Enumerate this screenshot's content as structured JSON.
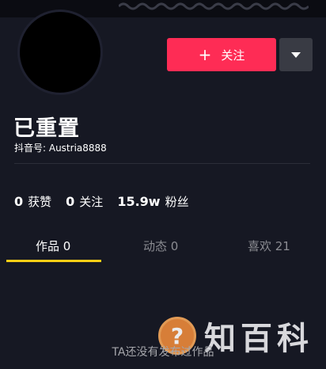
{
  "profile": {
    "nickname": "已重置",
    "douyin_id": "抖音号: Austria8888"
  },
  "actions": {
    "follow_plus": "+",
    "follow_label": "关注",
    "more_icon": "caret-down-icon"
  },
  "stats": [
    {
      "num": "0",
      "label": "获赞"
    },
    {
      "num": "0",
      "label": "关注"
    },
    {
      "num": "15.9w",
      "label": "粉丝"
    }
  ],
  "tabs": [
    {
      "label": "作品 0",
      "active": true
    },
    {
      "label": "动态 0",
      "active": false
    },
    {
      "label": "喜欢 21",
      "active": false
    }
  ],
  "empty_message": "TA还没有发布过作品",
  "watermark": {
    "icon_glyph": "?",
    "text": "知百科"
  },
  "colors": {
    "background": "#161823",
    "follow_button": "#fe2c55",
    "tab_indicator": "#face15"
  }
}
